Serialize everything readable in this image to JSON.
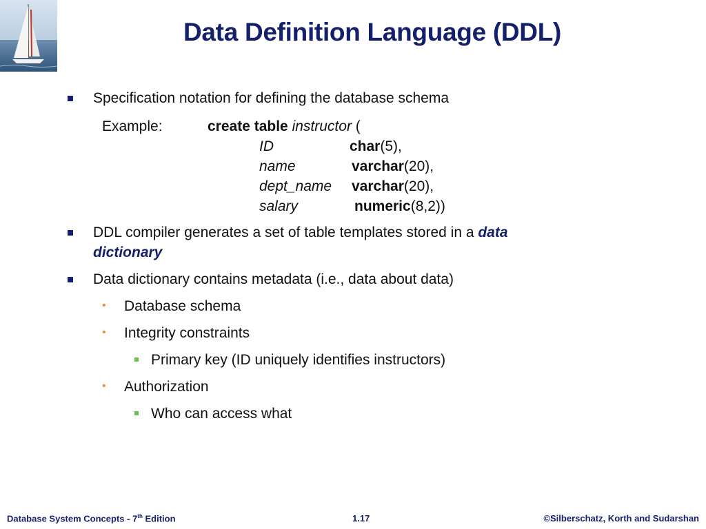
{
  "slide": {
    "title": "Data Definition Language (DDL)"
  },
  "bullets": {
    "spec": "Specification notation for defining the database schema",
    "ddl_compiler_pre": "DDL compiler generates a set of table templates stored in a ",
    "ddl_compiler_em1": "data",
    "ddl_compiler_em2": "dictionary",
    "data_dictionary": "Data dictionary contains metadata (i.e., data about data)",
    "db_schema": "Database schema",
    "integrity": "Integrity constraints",
    "primary_key": "Primary key (ID uniquely identifies instructors)",
    "authorization": "Authorization",
    "who_access": "Who can access what"
  },
  "example": {
    "label": "Example:",
    "create_kw": "create table",
    "table_name": "instructor",
    "open_paren": " (",
    "rows": [
      {
        "col": "ID",
        "type": "char",
        "args": "(5),"
      },
      {
        "col": "name",
        "type": "varchar",
        "args": "(20),"
      },
      {
        "col": "dept_name",
        "type": "varchar",
        "args": "(20),"
      },
      {
        "col": "salary",
        "type": "numeric",
        "args": "(8,2))"
      }
    ]
  },
  "footer": {
    "left_pre": "Database System Concepts - 7",
    "left_sup": "th",
    "left_post": " Edition",
    "page": "1.17",
    "copyright": "©Silberschatz, Korth and Sudarshan"
  },
  "colors": {
    "title": "#14206b",
    "level1_bullet": "#14206b",
    "level2_bullet": "#e8923a",
    "level3_bullet": "#6bbf4e",
    "emphasis": "#14206b"
  },
  "icons": {
    "logo": "sailboat-logo"
  }
}
